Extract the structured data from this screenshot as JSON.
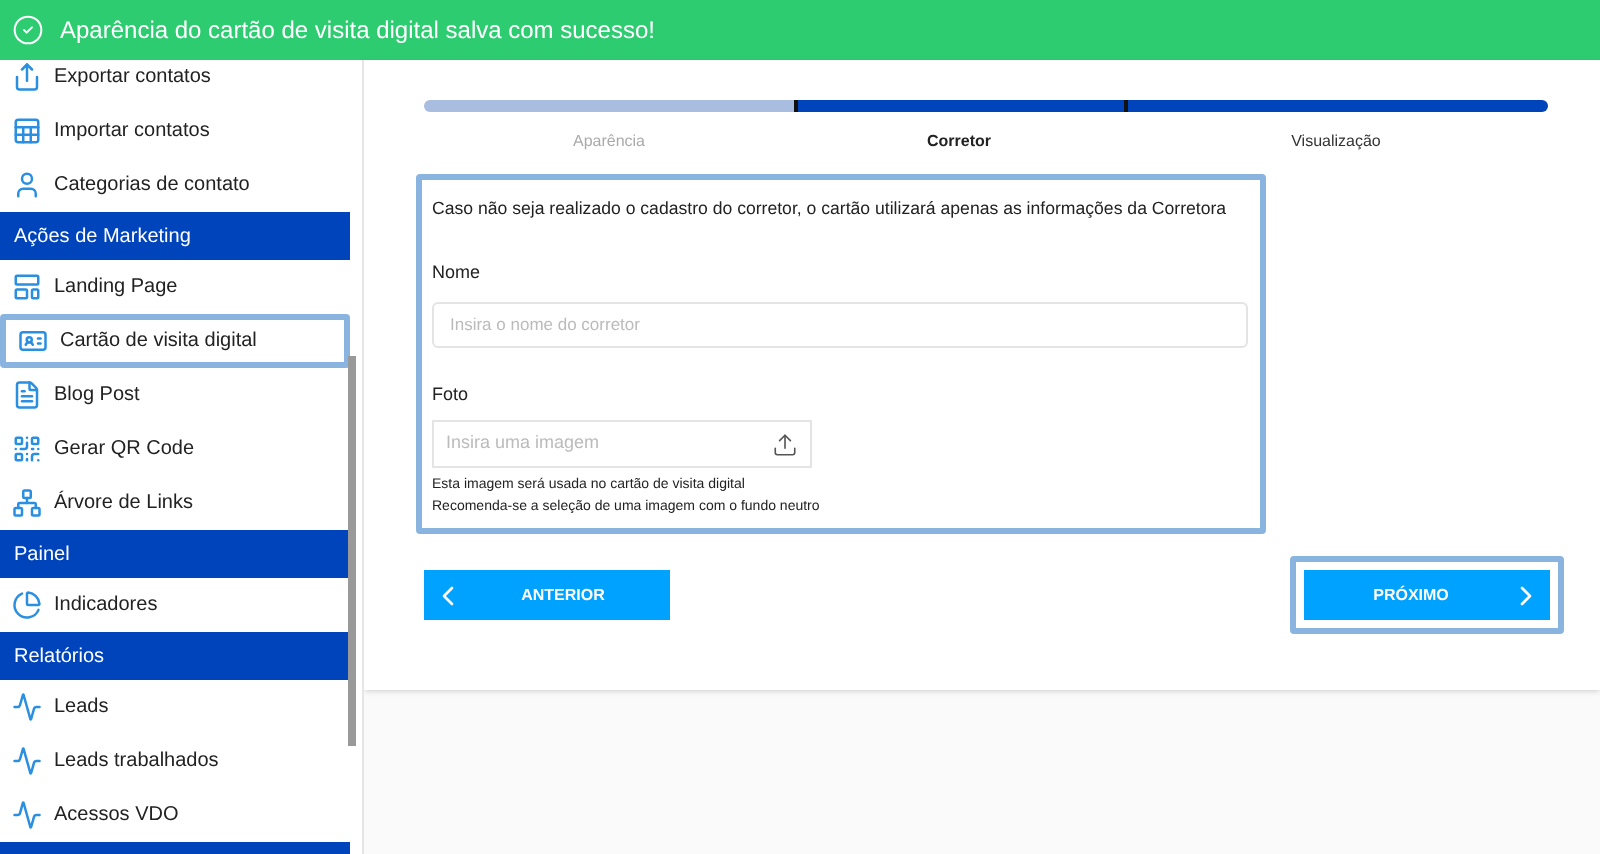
{
  "toast": {
    "message": "Aparência do cartão de visita digital salva com sucesso!"
  },
  "sidebar": {
    "items": [
      {
        "kind": "item",
        "label": "Exportar contatos",
        "selected": false
      },
      {
        "kind": "item",
        "label": "Importar contatos",
        "selected": false
      },
      {
        "kind": "item",
        "label": "Categorias de contato",
        "selected": false
      },
      {
        "kind": "section",
        "label": "Ações de Marketing"
      },
      {
        "kind": "item",
        "label": "Landing Page",
        "selected": false
      },
      {
        "kind": "item",
        "label": "Cartão de visita digital",
        "selected": true
      },
      {
        "kind": "item",
        "label": "Blog Post",
        "selected": false
      },
      {
        "kind": "item",
        "label": "Gerar QR Code",
        "selected": false
      },
      {
        "kind": "item",
        "label": "Árvore de Links",
        "selected": false
      },
      {
        "kind": "section",
        "label": "Painel"
      },
      {
        "kind": "item",
        "label": "Indicadores",
        "selected": false
      },
      {
        "kind": "section",
        "label": "Relatórios"
      },
      {
        "kind": "item",
        "label": "Leads",
        "selected": false
      },
      {
        "kind": "item",
        "label": "Leads trabalhados",
        "selected": false
      },
      {
        "kind": "item",
        "label": "Acessos VDO",
        "selected": false
      },
      {
        "kind": "section"
      }
    ]
  },
  "stepper": {
    "steps": [
      {
        "label": "Aparência",
        "done": true,
        "selected": false
      },
      {
        "label": "Corretor",
        "done": false,
        "selected": true
      },
      {
        "label": "Visualização",
        "done": false,
        "selected": false
      }
    ]
  },
  "form": {
    "notice": "Caso não seja realizado o cadastro do corretor, o cartão utilizará apenas as informações da Corretora",
    "name_label": "Nome",
    "name_placeholder": "Insira o nome do corretor",
    "photo_label": "Foto",
    "photo_placeholder": "Insira uma imagem",
    "hints": [
      "Esta imagem será usada no cartão de visita digital",
      "Recomenda-se a seleção de uma imagem com o fundo neutro"
    ]
  },
  "buttons": [
    {
      "kind": "back",
      "label": "ANTERIOR",
      "highlighted": false
    },
    {
      "kind": "next",
      "label": "PRÓXIMO",
      "highlighted": true
    }
  ]
}
